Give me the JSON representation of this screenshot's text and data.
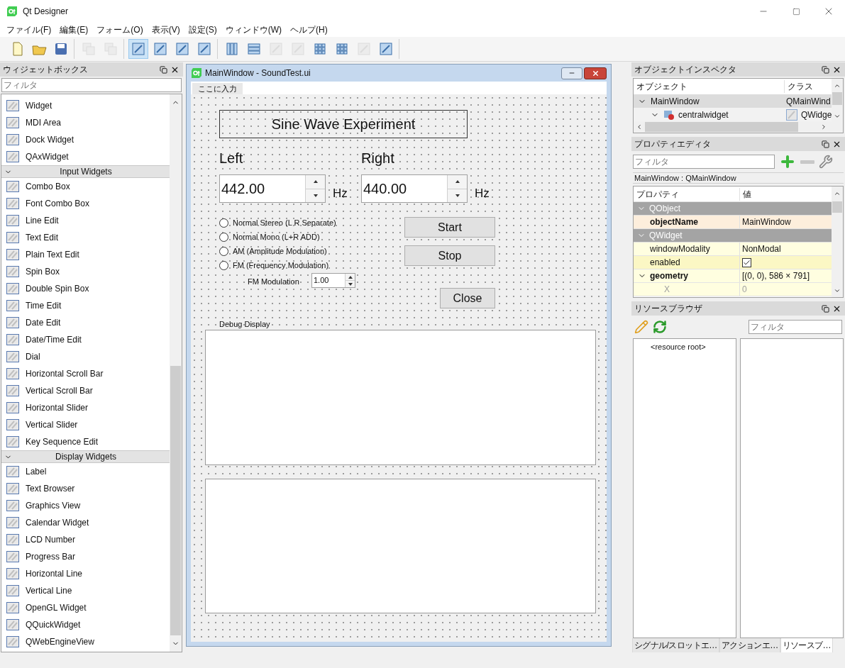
{
  "window": {
    "title": "Qt Designer"
  },
  "menu": [
    "ファイル(F)",
    "編集(E)",
    "フォーム(O)",
    "表示(V)",
    "設定(S)",
    "ウィンドウ(W)",
    "ヘルプ(H)"
  ],
  "toolbar": [
    [
      {
        "selected": false,
        "disabled": false
      },
      {
        "selected": false,
        "disabled": false
      },
      {
        "selected": false,
        "disabled": false
      }
    ],
    [
      {
        "selected": false,
        "disabled": true
      },
      {
        "selected": false,
        "disabled": true
      }
    ],
    [
      {
        "selected": true,
        "disabled": false
      },
      {
        "selected": false,
        "disabled": false
      },
      {
        "selected": false,
        "disabled": false
      },
      {
        "selected": false,
        "disabled": false
      }
    ],
    [
      {
        "selected": false,
        "disabled": false
      },
      {
        "selected": false,
        "disabled": false
      },
      {
        "selected": false,
        "disabled": true
      },
      {
        "selected": false,
        "disabled": true
      },
      {
        "selected": false,
        "disabled": false
      },
      {
        "selected": false,
        "disabled": false
      },
      {
        "selected": false,
        "disabled": true
      },
      {
        "selected": false,
        "disabled": false
      }
    ]
  ],
  "widget_box": {
    "title": "ウィジェットボックス",
    "filter_placeholder": "フィルタ",
    "sections": [
      {
        "items": [
          "Widget",
          "MDI Area",
          "Dock Widget",
          "QAxWidget"
        ]
      },
      {
        "title": "Input Widgets",
        "expanded": true,
        "items": [
          "Combo Box",
          "Font Combo Box",
          "Line Edit",
          "Text Edit",
          "Plain Text Edit",
          "Spin Box",
          "Double Spin Box",
          "Time Edit",
          "Date Edit",
          "Date/Time Edit",
          "Dial",
          "Horizontal Scroll Bar",
          "Vertical Scroll Bar",
          "Horizontal Slider",
          "Vertical Slider",
          "Key Sequence Edit"
        ]
      },
      {
        "title": "Display Widgets",
        "expanded": true,
        "items": [
          "Label",
          "Text Browser",
          "Graphics View",
          "Calendar Widget",
          "LCD Number",
          "Progress Bar",
          "Horizontal Line",
          "Vertical Line",
          "OpenGL Widget",
          "QQuickWidget",
          "QWebEngineView"
        ]
      }
    ]
  },
  "form_window": {
    "title": "MainWindow - SoundTest.ui",
    "menu_placeholder": "ここに入力",
    "heading": "Sine Wave Experiment",
    "left": {
      "label": "Left",
      "value": "442.00",
      "unit": "Hz"
    },
    "right": {
      "label": "Right",
      "value": "440.00",
      "unit": "Hz"
    },
    "modes": [
      {
        "label": "Normal Stereo (L R Separate)",
        "selected": false
      },
      {
        "label": "Normal Mono (L+R ADD)",
        "selected": false
      },
      {
        "label": "AM (Amplitude Modulation)",
        "selected": false
      },
      {
        "label": "FM (Frequency Modulation)",
        "selected": false
      }
    ],
    "fm_modulation": {
      "label": "FM Modulation",
      "value": "1.00"
    },
    "buttons": [
      "Start",
      "Stop",
      "Close"
    ],
    "debug_label": "Debug Display"
  },
  "object_inspector": {
    "title": "オブジェクトインスペクタ",
    "columns": [
      "オブジェクト",
      "クラス"
    ],
    "rows": [
      {
        "name": "MainWindow",
        "class": "QMainWind",
        "selected": true,
        "expanded": true,
        "children": [
          {
            "name": "centralwidget",
            "class": "QWidge",
            "selected": false,
            "expanded": true
          }
        ]
      }
    ]
  },
  "property_editor": {
    "title": "プロパティエディタ",
    "filter_placeholder": "フィルタ",
    "context": "MainWindow : QMainWindow",
    "columns": [
      "プロパティ",
      "値"
    ],
    "rows": [
      {
        "kind": "group",
        "name": "QObject",
        "expanded": true
      },
      {
        "kind": "property",
        "name": "objectName",
        "value": "MainWindow",
        "modified": true
      },
      {
        "kind": "group",
        "name": "QWidget",
        "expanded": true
      },
      {
        "kind": "property",
        "name": "windowModality",
        "value": "NonModal",
        "modified": false
      },
      {
        "kind": "check",
        "name": "enabled",
        "checked": true,
        "modified": false
      },
      {
        "kind": "property",
        "name": "geometry",
        "value": "[(0, 0), 586 × 791]",
        "modified": true,
        "expanded": true,
        "children": [
          {
            "name": "X",
            "value": "0",
            "modified": false
          }
        ]
      }
    ]
  },
  "resource_browser": {
    "title": "リソースブラウザ",
    "filter_placeholder": "フィルタ",
    "root": "<resource root>"
  },
  "bottom_tabs": [
    {
      "label": "シグナル/スロットエ…",
      "selected": false
    },
    {
      "label": "アクションエ…",
      "selected": false
    },
    {
      "label": "リソースブ…",
      "selected": true
    }
  ]
}
